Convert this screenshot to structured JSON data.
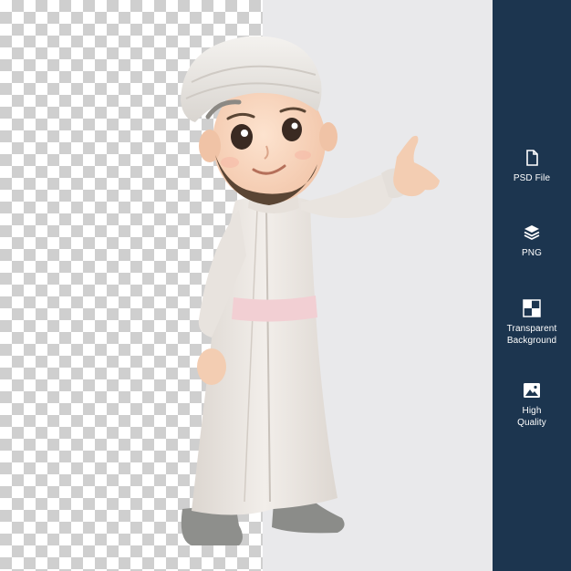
{
  "colors": {
    "sidebar": "#1c354f",
    "checker_dark": "#cfcfcf",
    "checker_light": "#ffffff",
    "panel_light": "#e9e9eb",
    "robe": "#eeeae6",
    "sash": "#f2cfd3",
    "shoes": "#8e8f8c"
  },
  "sidebar": {
    "features": [
      {
        "icon": "file-icon",
        "label": "PSD File"
      },
      {
        "icon": "layers-icon",
        "label": "PNG"
      },
      {
        "icon": "transparency-icon",
        "label": "Transparent\nBackground"
      },
      {
        "icon": "image-icon",
        "label": "High\nQuality"
      }
    ]
  }
}
